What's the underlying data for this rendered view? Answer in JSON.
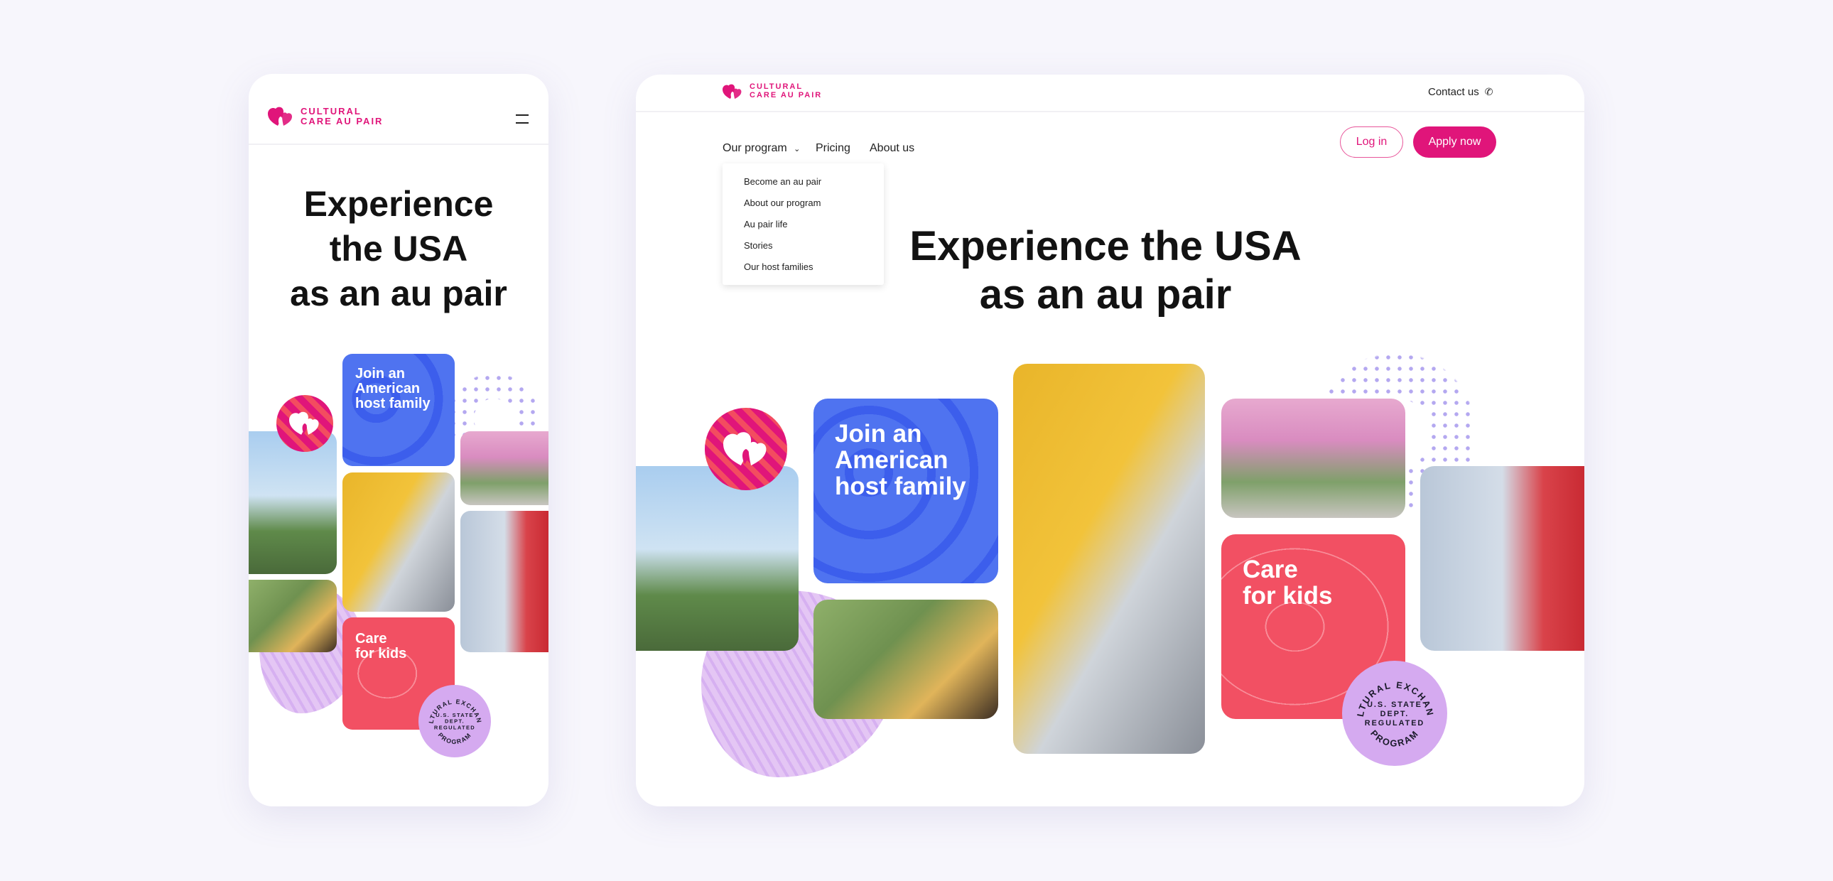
{
  "brand": {
    "line1": "CULTURAL",
    "line2": "CARE AU PAIR",
    "color": "#e0157a"
  },
  "colors": {
    "blue": "#4f73f0",
    "red": "#f25063",
    "lilac": "#d5aaf0",
    "pink": "#e0157a"
  },
  "mobile": {
    "menu_icon": "hamburger-icon",
    "heading": [
      "Experience",
      "the USA",
      "as an au pair"
    ],
    "tiles": {
      "join": [
        "Join an",
        "American",
        "host family"
      ],
      "care": [
        "Care",
        "for kids"
      ]
    }
  },
  "desktop": {
    "contact": "Contact us",
    "contact_icon": "phone-icon",
    "nav": {
      "program": "Our program",
      "pricing": "Pricing",
      "about": "About us"
    },
    "dropdown": [
      "Become an au pair",
      "About our program",
      "Au pair life",
      "Stories",
      "Our host families"
    ],
    "login": "Log in",
    "apply": "Apply now",
    "heading": [
      "Experience the USA",
      "as an au pair"
    ],
    "tiles": {
      "join": [
        "Join an",
        "American",
        "host family"
      ],
      "care": [
        "Care",
        "for kids"
      ]
    }
  },
  "badge": {
    "outer": "CULTURAL EXCHANGE",
    "inner": [
      "U.S. STATE",
      "DEPT.",
      "REGULATED"
    ],
    "bottom": "~PROGRAM~"
  }
}
